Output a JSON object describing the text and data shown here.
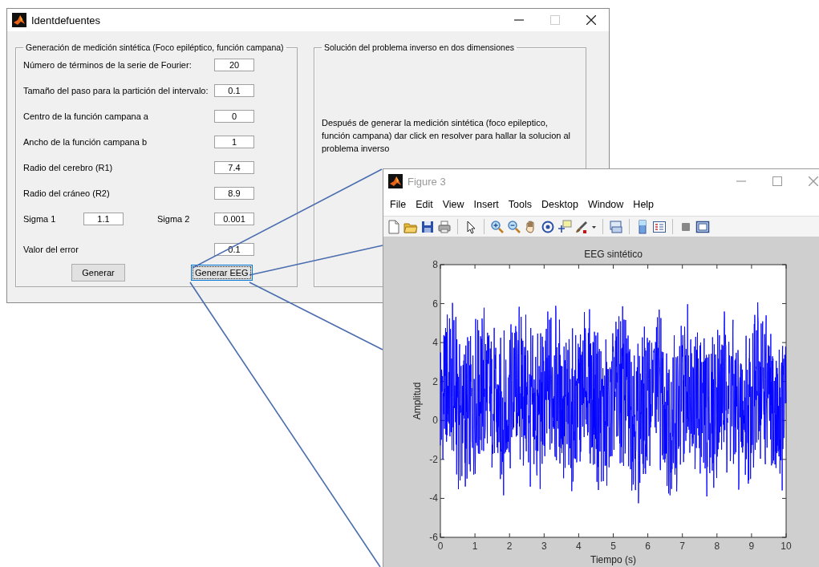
{
  "main_window": {
    "title": "Identdefuentes",
    "active": true,
    "synthetic_panel": {
      "title": "Generación de medición sintética (Foco epiléptico, función campana)",
      "rows": [
        {
          "fields": [
            {
              "label": "Número de términos de la serie de Fourier:",
              "value": "20"
            }
          ]
        },
        {
          "fields": [
            {
              "label": "Tamaño del paso para la partición del intervalo:",
              "value": "0.1"
            }
          ]
        },
        {
          "fields": [
            {
              "label": "Centro de la función campana a",
              "value": "0"
            }
          ]
        },
        {
          "fields": [
            {
              "label": "Ancho de la función campana b",
              "value": "1"
            }
          ]
        },
        {
          "fields": [
            {
              "label": "Radio del cerebro (R1)",
              "value": "7.4"
            }
          ]
        },
        {
          "fields": [
            {
              "label": "Radio del cráneo (R2)",
              "value": "8.9"
            }
          ]
        },
        {
          "fields": [
            {
              "label": "Sigma 1",
              "value": "1.1"
            },
            {
              "label": "Sigma 2",
              "value": "0.001"
            }
          ]
        },
        {
          "fields": [
            {
              "label": "Valor del error",
              "value": "0.1"
            }
          ]
        }
      ],
      "buttons": [
        {
          "label": "Generar",
          "focused": false
        },
        {
          "label": "Generar EEG",
          "focused": true
        }
      ]
    },
    "inverse_panel": {
      "title": "Solución del problema inverso en dos dimensiones",
      "text": "Después de generar la medición sintética (foco epileptico, función campana) dar click en resolver para hallar la solucion al problema inverso"
    }
  },
  "figure_window": {
    "title": "Figure 3",
    "active": false,
    "menu": [
      "File",
      "Edit",
      "View",
      "Insert",
      "Tools",
      "Desktop",
      "Window",
      "Help"
    ],
    "plot": {
      "title": "EEG sintético",
      "xlabel": "Tiempo (s)",
      "ylabel": "Amplitud",
      "xticks": [
        "0",
        "1",
        "2",
        "3",
        "4",
        "5",
        "6",
        "7",
        "8",
        "9",
        "10"
      ],
      "yticks": [
        "8",
        "6",
        "4",
        "2",
        "0",
        "-2",
        "-4",
        "-6"
      ]
    }
  }
}
